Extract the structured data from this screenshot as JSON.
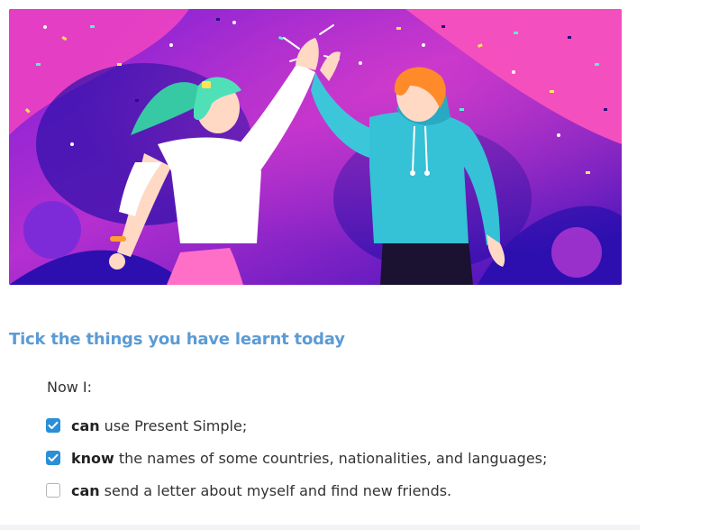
{
  "hero": {
    "colors": {
      "purple": "#6a1fd0",
      "magenta": "#e43fc4",
      "navy": "#2d0fb0"
    }
  },
  "section": {
    "heading": "Tick the things you have learnt today",
    "intro": "Now I:",
    "items": [
      {
        "bold": "can",
        "text": "use Present Simple;",
        "checked": true
      },
      {
        "bold": "know",
        "text": "the names of some countries, nationalities, and languages;",
        "checked": true
      },
      {
        "bold": "can",
        "text": "send a letter about myself and find new friends.",
        "checked": false
      }
    ]
  },
  "colors": {
    "heading": "#5b9bd5",
    "checkbox": "#2a8fd6"
  }
}
